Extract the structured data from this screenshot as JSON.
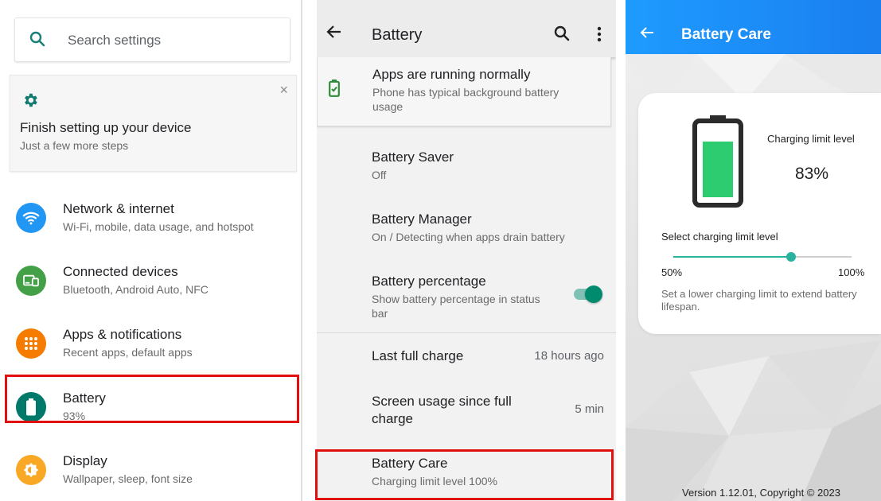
{
  "panel1": {
    "search_placeholder": "Search settings",
    "setup_card": {
      "title": "Finish setting up your device",
      "subtitle": "Just a few more steps",
      "close": "×"
    },
    "items": [
      {
        "title": "Network & internet",
        "subtitle": "Wi-Fi, mobile, data usage, and hotspot",
        "icon": "wifi-icon",
        "color": "#2196f3"
      },
      {
        "title": "Connected devices",
        "subtitle": "Bluetooth, Android Auto, NFC",
        "icon": "connected-devices-icon",
        "color": "#43a047"
      },
      {
        "title": "Apps & notifications",
        "subtitle": "Recent apps, default apps",
        "icon": "apps-grid-icon",
        "color": "#f57c00"
      },
      {
        "title": "Battery",
        "subtitle": "93%",
        "icon": "battery-icon",
        "color": "#00796b"
      },
      {
        "title": "Display",
        "subtitle": "Wallpaper, sleep, font size",
        "icon": "brightness-icon",
        "color": "#f9a825"
      }
    ]
  },
  "panel2": {
    "title": "Battery",
    "status": {
      "title": "Apps are running normally",
      "subtitle": "Phone has typical background battery usage"
    },
    "items": [
      {
        "title": "Battery Saver",
        "subtitle": "Off"
      },
      {
        "title": "Battery Manager",
        "subtitle": "On / Detecting when apps drain battery"
      },
      {
        "title": "Battery percentage",
        "subtitle": "Show battery percentage in status bar",
        "toggle_on": true
      }
    ],
    "last_full_charge": {
      "label": "Last full charge",
      "value": "18 hours ago"
    },
    "screen_usage": {
      "label": "Screen usage since full charge",
      "value": "5 min"
    },
    "battery_care": {
      "title": "Battery Care",
      "subtitle": "Charging limit level 100%"
    }
  },
  "panel3": {
    "title": "Battery Care",
    "charging_limit_label": "Charging limit level",
    "charging_limit_value": "83%",
    "select_label": "Select charging limit level",
    "slider": {
      "min": 50,
      "max": 100,
      "value": 83,
      "min_label": "50%",
      "max_label": "100%"
    },
    "hint": "Set a lower charging limit to extend battery lifespan.",
    "version": "Version 1.12.01, Copyright © 2023",
    "accent": "#27b39d",
    "header_color": "#1e8bff"
  },
  "highlight_color": "#e20f0f"
}
